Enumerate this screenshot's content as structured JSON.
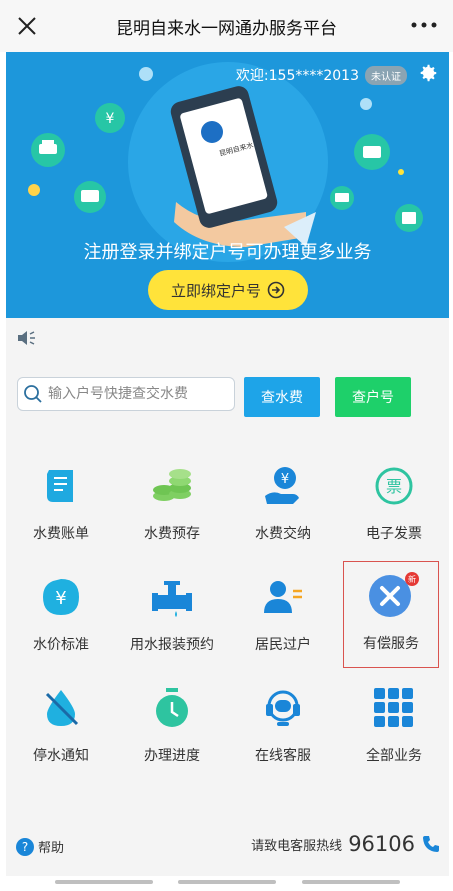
{
  "titlebar": {
    "title": "昆明自来水一网通办服务平台",
    "close_icon": "close-icon",
    "more_icon": "more-dots-icon"
  },
  "banner": {
    "welcome": "欢迎:155****2013",
    "auth_badge": "未认证",
    "tagline": "注册登录并绑定户号可办理更多业务",
    "bind_button": "立即绑定户号",
    "phone_logo_text": "昆明自来水",
    "bg_color": "#1d97db",
    "button_color": "#ffe33a"
  },
  "search": {
    "placeholder": "输入户号快捷查交水费",
    "value": "",
    "water_fee_button": "查水费",
    "account_button": "查户号"
  },
  "services": [
    {
      "label": "水费账单",
      "icon": "bill-icon"
    },
    {
      "label": "水费预存",
      "icon": "coins-icon"
    },
    {
      "label": "水费交纳",
      "icon": "pay-yuan-icon"
    },
    {
      "label": "电子发票",
      "icon": "invoice-icon"
    },
    {
      "label": "水价标准",
      "icon": "price-icon"
    },
    {
      "label": "用水报装预约",
      "icon": "faucet-icon"
    },
    {
      "label": "居民过户",
      "icon": "transfer-user-icon"
    },
    {
      "label": "有偿服务",
      "icon": "tools-icon",
      "badge": "新"
    },
    {
      "label": "停水通知",
      "icon": "water-off-icon"
    },
    {
      "label": "办理进度",
      "icon": "timer-icon"
    },
    {
      "label": "在线客服",
      "icon": "headset-icon"
    },
    {
      "label": "全部业务",
      "icon": "grid-icon"
    }
  ],
  "footer": {
    "help": "帮助",
    "hotline_text": "请致电客服热线",
    "hotline_number": "96106"
  },
  "colors": {
    "primary_blue": "#1ea4e8",
    "green": "#1ed06a",
    "highlight_red": "#d9534f"
  }
}
